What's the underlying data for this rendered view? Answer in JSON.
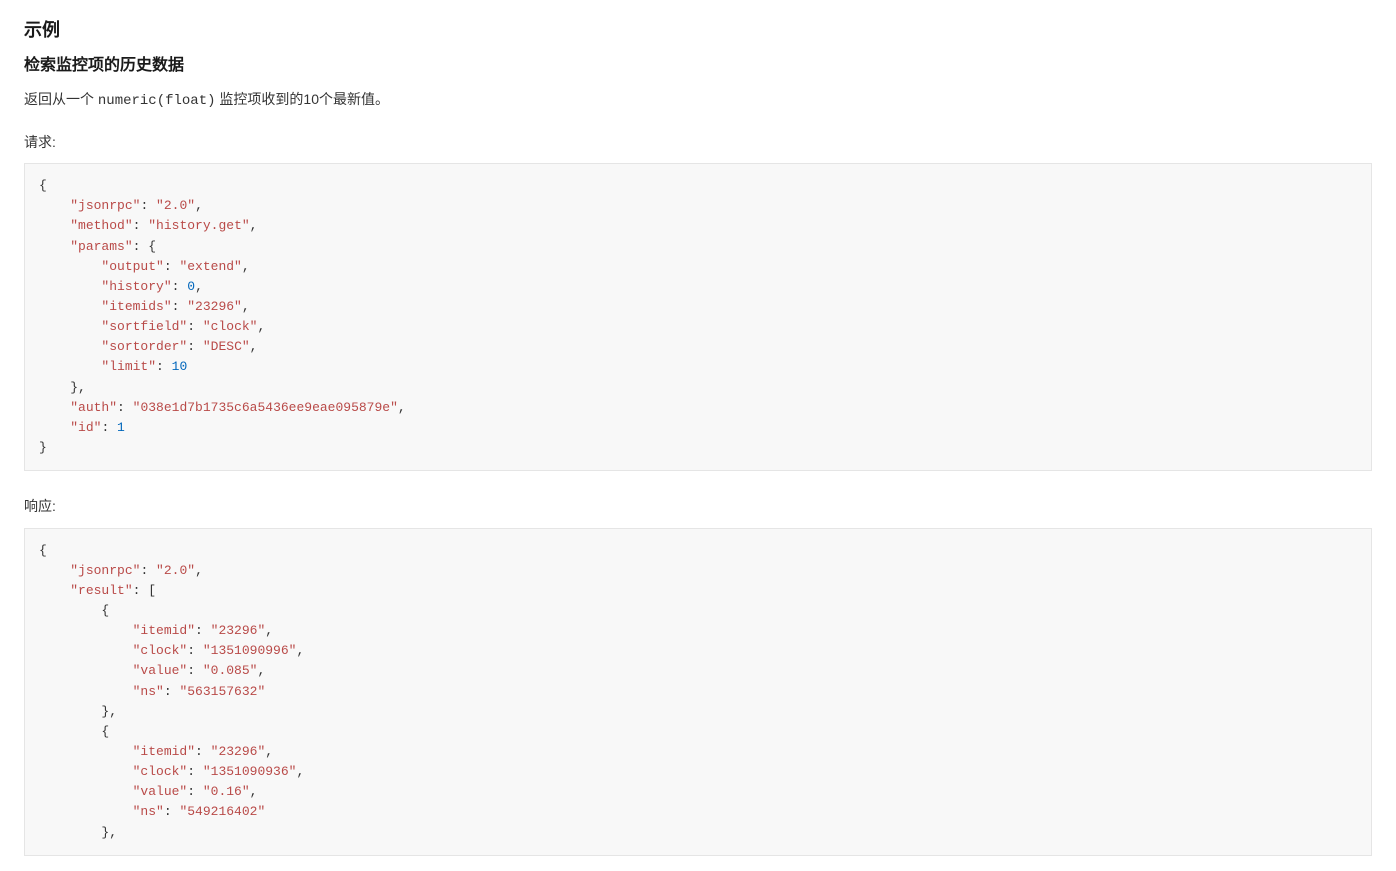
{
  "headings": {
    "section": "示例",
    "sub": "检索监控项的历史数据"
  },
  "desc": {
    "prefix": "返回从一个 ",
    "mono": "numeric(float)",
    "suffix": " 监控项收到的10个最新值。"
  },
  "labels": {
    "request": "请求:",
    "response": "响应:"
  },
  "request_json": {
    "jsonrpc": "2.0",
    "method": "history.get",
    "params": {
      "output": "extend",
      "history": 0,
      "itemids": "23296",
      "sortfield": "clock",
      "sortorder": "DESC",
      "limit": 10
    },
    "auth": "038e1d7b1735c6a5436ee9eae095879e",
    "id": 1
  },
  "response_json_visible": {
    "jsonrpc": "2.0",
    "result": [
      {
        "itemid": "23296",
        "clock": "1351090996",
        "value": "0.085",
        "ns": "563157632"
      },
      {
        "itemid": "23296",
        "clock": "1351090936",
        "value": "0.16",
        "ns": "549216402"
      }
    ]
  }
}
